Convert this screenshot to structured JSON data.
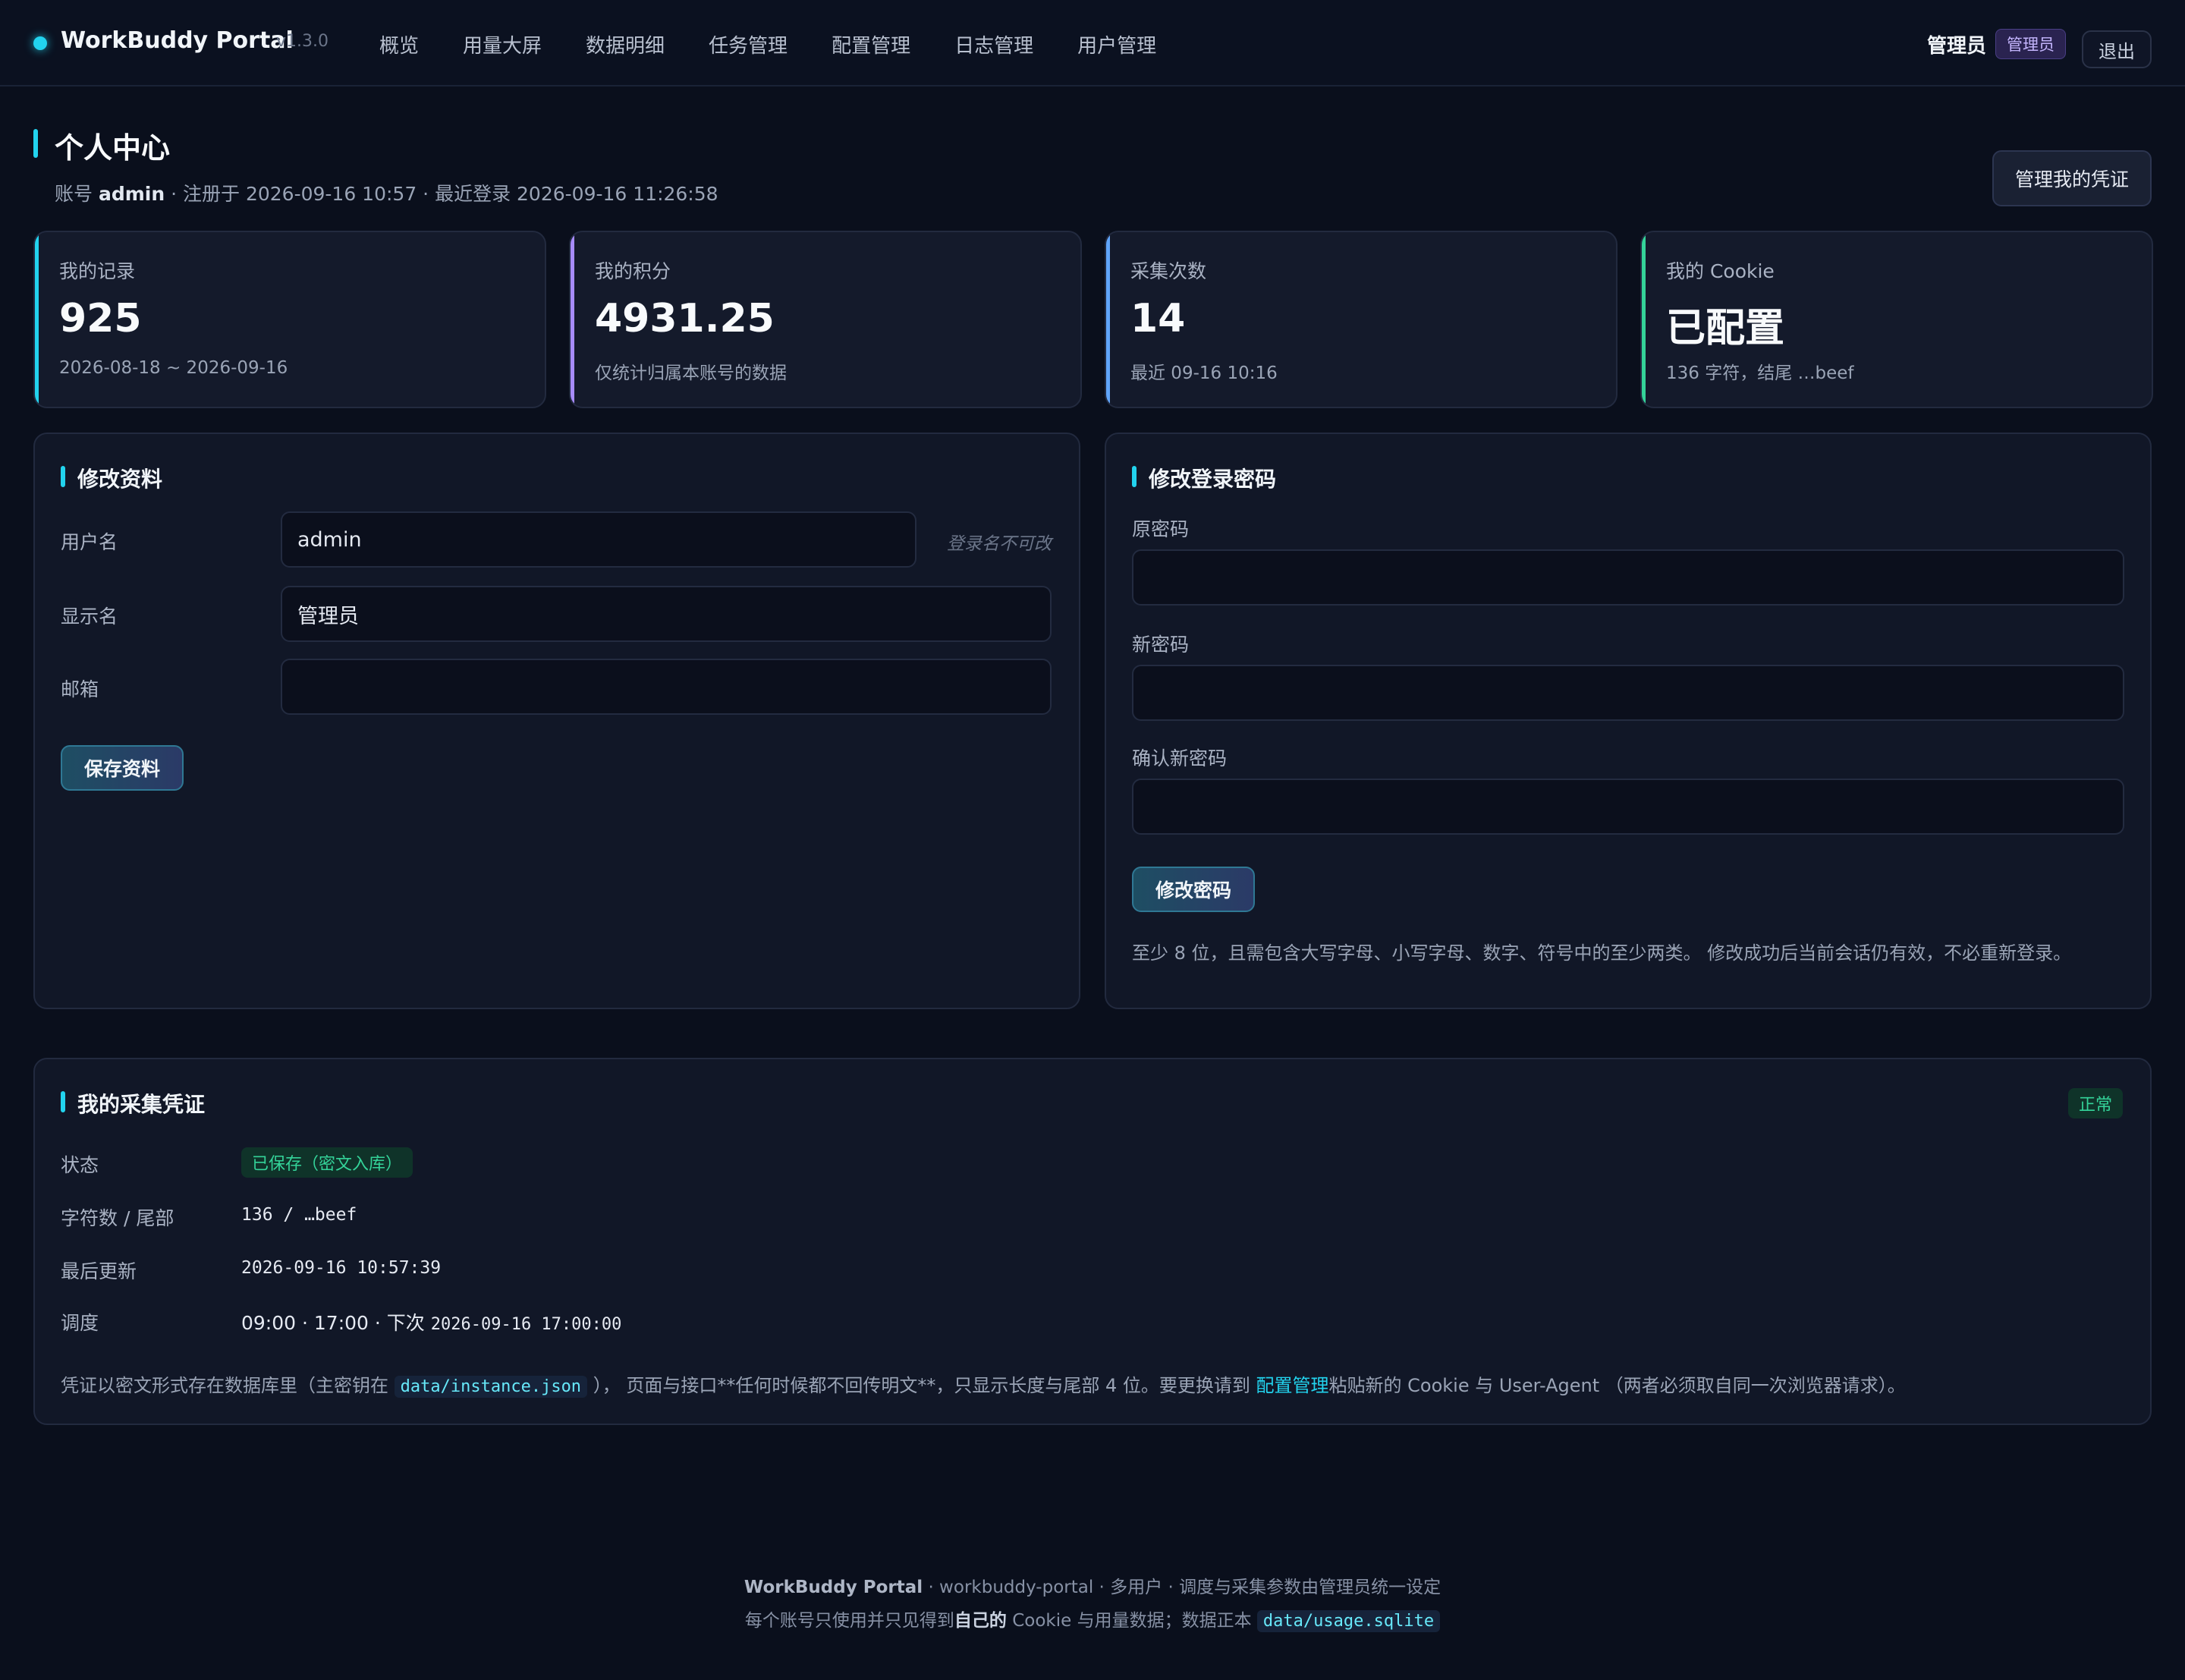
{
  "app": {
    "name": "WorkBuddy Portal",
    "version": "v1.3.0",
    "brand_color": "#22d3ee"
  },
  "nav": [
    {
      "label": "概览"
    },
    {
      "label": "用量大屏"
    },
    {
      "label": "数据明细"
    },
    {
      "label": "任务管理"
    },
    {
      "label": "配置管理"
    },
    {
      "label": "日志管理"
    },
    {
      "label": "用户管理"
    }
  ],
  "user": {
    "name": "管理员",
    "role": "管理员",
    "logout": "退出"
  },
  "header": {
    "title": "个人中心",
    "sub_prefix": "账号",
    "account": "admin",
    "sub_rest": "· 注册于 2026-09-16 10:57 · 最近登录 2026-09-16 11:26:58",
    "cred_button": "管理我的凭证"
  },
  "stats": [
    {
      "label": "我的记录",
      "value": "925",
      "note": "2026-08-18 ~ 2026-09-16",
      "accent": "#22d3ee"
    },
    {
      "label": "我的积分",
      "value": "4931.25",
      "note": "仅统计归属本账号的数据",
      "accent": "#a78bfa"
    },
    {
      "label": "采集次数",
      "value": "14",
      "note": "最近 09-16 10:16",
      "accent": "#60a5fa"
    },
    {
      "label": "我的 Cookie",
      "value": "已配置",
      "note": "136 字符，结尾 …beef",
      "accent": "#34d399"
    }
  ],
  "profile": {
    "title": "修改资料",
    "username_label": "用户名",
    "username_value": "admin",
    "username_hint": "登录名不可改",
    "display_label": "显示名",
    "display_value": "管理员",
    "email_label": "邮箱",
    "email_value": "",
    "save": "保存资料"
  },
  "password": {
    "title": "修改登录密码",
    "old_label": "原密码",
    "new_label": "新密码",
    "confirm_label": "确认新密码",
    "submit": "修改密码",
    "note": "至少 8 位，且需包含大写字母、小写字母、数字、符号中的至少两类。 修改成功后当前会话仍有效，不必重新登录。"
  },
  "credential": {
    "title": "我的采集凭证",
    "status_badge": "正常",
    "rows": {
      "status_label": "状态",
      "status_value": "已保存（密文入库）",
      "chars_label": "字符数 / 尾部",
      "chars_value": "136 / …beef",
      "updated_label": "最后更新",
      "updated_value": "2026-09-16 10:57:39",
      "schedule_label": "调度",
      "schedule_value": "09:00 · 17:00 · 下次",
      "schedule_next": "2026-09-16 17:00:00"
    },
    "note_a": "凭证以密文形式存在数据库里（主密钥在",
    "note_code": "data/instance.json",
    "note_b": "）， 页面与接口**任何时候都不回传明文**，只显示长度与尾部 4 位。要更换请到",
    "note_link": "配置管理",
    "note_c": "粘贴新的 Cookie 与 User-Agent （两者必须取自同一次浏览器请求）。"
  },
  "footer": {
    "line1_bold": "WorkBuddy Portal",
    "line1_rest": "· workbuddy-portal · 多用户 · 调度与采集参数由管理员统一设定",
    "line2_a": "每个账号只使用并只见得到",
    "line2_bold": "自己的",
    "line2_b": "Cookie 与用量数据；数据正本",
    "line2_code": "data/usage.sqlite"
  }
}
